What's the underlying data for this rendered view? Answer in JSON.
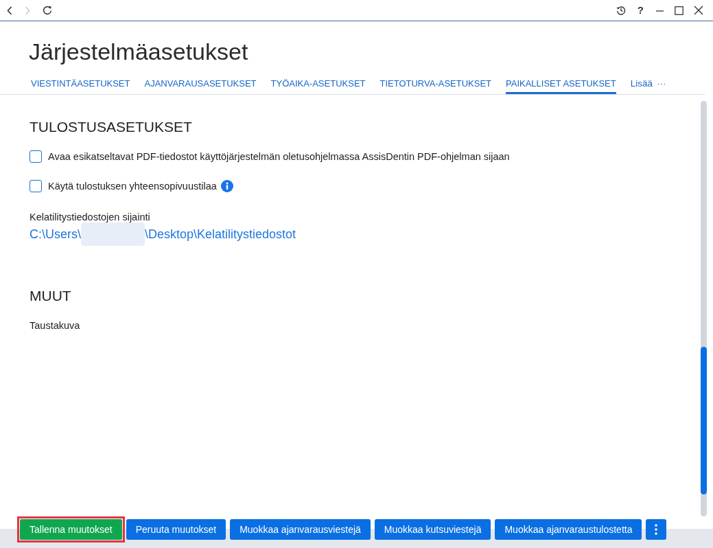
{
  "toolbar": {
    "nav_buttons": [
      {
        "kind": "back",
        "disabled": false
      },
      {
        "kind": "forward",
        "disabled": true
      },
      {
        "kind": "reload",
        "disabled": false
      }
    ],
    "help_label": "?"
  },
  "page": {
    "title": "Järjestelmäasetukset"
  },
  "tabs": [
    {
      "label": "VIESTINTÄASETUKSET",
      "selected": false
    },
    {
      "label": "AJANVARAUSASETUKSET",
      "selected": false
    },
    {
      "label": "TYÖAIKA-ASETUKSET",
      "selected": false
    },
    {
      "label": "TIETOTURVA-ASETUKSET",
      "selected": false
    },
    {
      "label": "PAIKALLISET ASETUKSET",
      "selected": true
    }
  ],
  "more_tab": {
    "label": "Lisää",
    "glyph": "···"
  },
  "sections": [
    {
      "heading": "TULOSTUSASETUKSET",
      "items": [
        {
          "kind": "checkbox",
          "label": "Avaa esikatseltavat PDF-tiedostot käyttöjärjestelmän oletusohjelmassa AssisDentin PDF-ohjelman sijaan",
          "checked": false,
          "info": false
        },
        {
          "kind": "checkbox",
          "label": "Käytä tulostuksen yhteensopivuustilaa",
          "checked": false,
          "info": true
        },
        {
          "kind": "path",
          "label": "Kelatilitystiedostojen sijainti",
          "path_start": "C:\\Users\\",
          "path_end": "\\Desktop\\Kelatilitystiedostot",
          "redacted": true
        }
      ]
    },
    {
      "heading": "MUUT",
      "items": [
        {
          "kind": "label",
          "label": "Taustakuva"
        }
      ]
    }
  ],
  "footer_buttons": [
    {
      "kind": "save",
      "label": "Tallenna muutokset",
      "highlighted": true
    },
    {
      "kind": "action",
      "label": "Peruuta muutokset",
      "highlighted": false
    },
    {
      "kind": "action",
      "label": "Muokkaa ajanvarausviestejä",
      "highlighted": false
    },
    {
      "kind": "action",
      "label": "Muokkaa kutsuviestejä",
      "highlighted": false
    },
    {
      "kind": "action",
      "label": "Muokkaa ajanvaraustulostetta",
      "highlighted": false
    },
    {
      "kind": "menu",
      "highlighted": false
    }
  ]
}
